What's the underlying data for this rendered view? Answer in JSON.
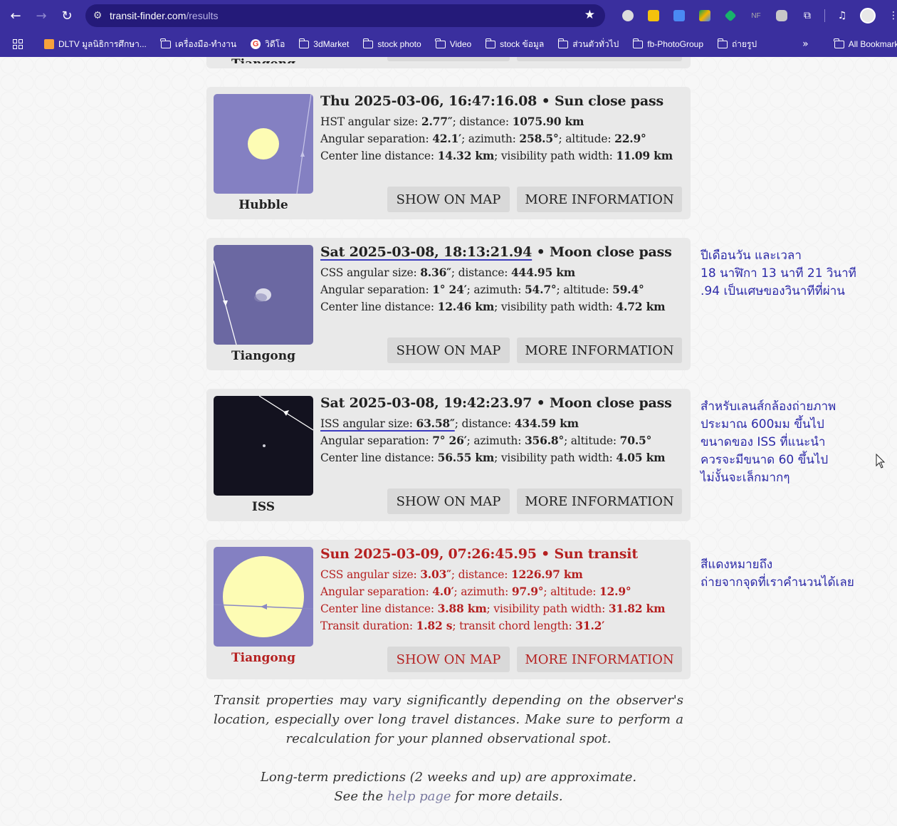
{
  "browser": {
    "url_host": "transit-finder.com",
    "url_path": "/results",
    "bookmarks": [
      {
        "label": "DLTV มูลนิธิการศึกษา..."
      },
      {
        "label": "เครื่องมือ-ทำงาน"
      },
      {
        "label": "วิดีโอ"
      },
      {
        "label": "3dMarket"
      },
      {
        "label": "stock photo"
      },
      {
        "label": "Video"
      },
      {
        "label": "stock ข้อมูล"
      },
      {
        "label": "ส่วนตัวทั่วไป"
      },
      {
        "label": "fb-PhotoGroup"
      },
      {
        "label": "ถ่ายรูป"
      }
    ],
    "all_bookmarks": "All Bookmarks",
    "ext_nf": "NF"
  },
  "prev_card": {
    "name": "Tiangong"
  },
  "passes": [
    {
      "title": "Thu 2025-03-06, 16:47:16.08",
      "event": "Sun close pass",
      "size_label": "HST angular size: ",
      "size": "2.77″",
      "dist_label": "; distance: ",
      "dist": "1075.90 km",
      "sep": "42.1′",
      "az": "258.5°",
      "alt": "22.9°",
      "cld": "14.32 km",
      "vpw": "11.09 km",
      "name": "Hubble",
      "show_map": "SHOW ON MAP",
      "more_info": "MORE INFORMATION"
    },
    {
      "title": "Sat 2025-03-08, 18:13:21.94",
      "event": "Moon close pass",
      "size_label": "CSS angular size: ",
      "size": "8.36″",
      "dist_label": "; distance: ",
      "dist": "444.95 km",
      "sep": "1° 24′",
      "az": "54.7°",
      "alt": "59.4°",
      "cld": "12.46 km",
      "vpw": "4.72 km",
      "name": "Tiangong",
      "show_map": "SHOW ON MAP",
      "more_info": "MORE INFORMATION"
    },
    {
      "title": "Sat 2025-03-08, 19:42:23.97",
      "event": "Moon close pass",
      "size_label": "ISS angular size: ",
      "size": "63.58″",
      "dist_label": "; distance: ",
      "dist": "434.59 km",
      "sep": "7° 26′",
      "az": "356.8°",
      "alt": "70.5°",
      "cld": "56.55 km",
      "vpw": "4.05 km",
      "name": "ISS",
      "show_map": "SHOW ON MAP",
      "more_info": "MORE INFORMATION"
    },
    {
      "title": "Sun 2025-03-09, 07:26:45.95",
      "event": "Sun transit",
      "size_label": "CSS angular size: ",
      "size": "3.03″",
      "dist_label": "; distance: ",
      "dist": "1226.97 km",
      "sep": "4.0′",
      "az": "97.9°",
      "alt": "12.9°",
      "cld": "3.88 km",
      "vpw": "31.82 km",
      "duration": "1.82 s",
      "chord": "31.2′",
      "name": "Tiangong",
      "show_map": "SHOW ON MAP",
      "more_info": "MORE INFORMATION"
    }
  ],
  "labels": {
    "sep": "Angular separation: ",
    "az": "; azimuth: ",
    "alt": "; altitude: ",
    "cld": "Center line distance: ",
    "vpw": "; visibility path width: ",
    "dur": "Transit duration: ",
    "chord": "; transit chord length: ",
    "bullet": "•"
  },
  "annotations": {
    "a1": "ปีเดือนวัน และเวลา\n18 นาฬิกา 13 นาที 21 วินาที\n.94 เป็นเศษของวินาทีที่ผ่าน",
    "a2": "สำหรับเลนส์กล้องถ่ายภาพ\nประมาณ 600มม ขึ้นไป\nขนาดของ ISS ที่แนะนำ\nควรจะมีขนาด 60 ขึ้นไป\nไม่งั้นจะเล็กมากๆ",
    "a3": "สีแดงหมายถึง\nถ่ายจากจุดที่เราคำนวนได้เลย"
  },
  "footer": {
    "p1": "Transit properties may vary significantly depending on the observer's location, especially over long travel distances. Make sure to perform a recalculation for your planned observational spot.",
    "p2a": "Long-term predictions (2 weeks and up) are approximate.",
    "p2b_pre": "See the ",
    "p2b_link": "help page",
    "p2b_post": " for more details."
  },
  "colors": {
    "accent_red": "#b52020",
    "chrome": "#3a2f9e",
    "annotation": "#2c2aa8"
  }
}
